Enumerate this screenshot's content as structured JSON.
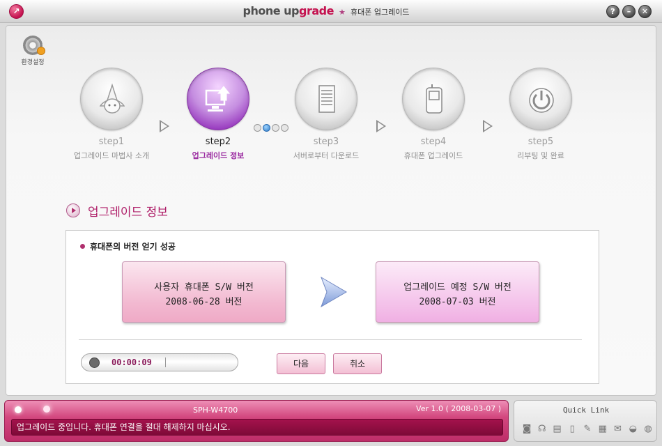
{
  "window": {
    "brand_main": "phone up",
    "brand_em": "grade",
    "star": "★",
    "subtitle": "휴대폰 업그레이드",
    "help_label": "?",
    "min_label": "–",
    "close_label": "✕"
  },
  "settings": {
    "label": "환경설정"
  },
  "steps": [
    {
      "num": "step1",
      "label": "업그레이드 마법사 소개",
      "icon": "wizard-icon",
      "active": false
    },
    {
      "num": "step2",
      "label": "업그레이드 정보",
      "icon": "computer-upload-icon",
      "active": true
    },
    {
      "num": "step3",
      "label": "서버로부터 다운로드",
      "icon": "server-icon",
      "active": false
    },
    {
      "num": "step4",
      "label": "휴대폰 업그레이드",
      "icon": "phone-icon",
      "active": false
    },
    {
      "num": "step5",
      "label": "리부팅 및 완료",
      "icon": "power-icon",
      "active": false
    }
  ],
  "section": {
    "title": "업그레이드 정보"
  },
  "content": {
    "status": "휴대폰의 버전 얻기 성공",
    "user_version_title": "사용자 휴대폰 S/W 버전",
    "user_version_value": "2008-06-28 버전",
    "new_version_title": "업그레이드 예정 S/W 버전",
    "new_version_value": "2008-07-03 버전",
    "elapsed": "00:00:09",
    "next_button": "다음",
    "cancel_button": "취소"
  },
  "status_bar": {
    "model": "SPH-W4700",
    "version": "Ver 1.0 ( 2008-03-07 )",
    "message": "업그레이드 중입니다. 휴대폰 연결을 절대 해제하지 마십시오."
  },
  "quick_link": {
    "title": "Quick Link",
    "icons": [
      "camera-icon",
      "headset-icon",
      "document-icon",
      "phone-icon",
      "memo-icon",
      "calendar-icon",
      "mail-icon",
      "car-icon",
      "globe-icon"
    ]
  },
  "colors": {
    "accent": "#b0206a",
    "active_step": "#9a3ec0",
    "bar": "#d3487f"
  }
}
